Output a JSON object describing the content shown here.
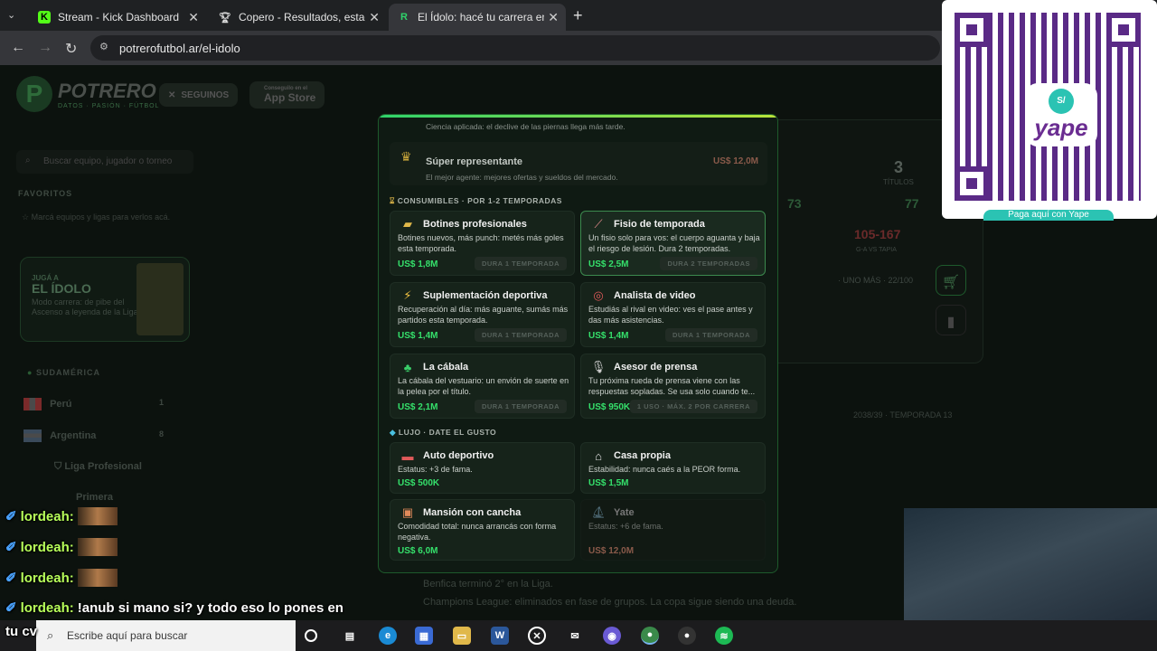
{
  "browser": {
    "tabs": [
      {
        "title": "Stream - Kick Dashboard",
        "icon": "kick-icon"
      },
      {
        "title": "Copero - Resultados, estadístic",
        "icon": "trophy-icon"
      },
      {
        "title": "El Ídolo: hacé tu carrera en la Li",
        "icon": "potrero-icon"
      }
    ],
    "url": "potrerofutbol.ar/el-idolo"
  },
  "site": {
    "brand": "POTRERO",
    "tagline": "DATOS · PASIÓN · FÚTBOL",
    "follow_label": "SEGUINOS",
    "appstore_small": "Conseguilo en el",
    "appstore_label": "App Store",
    "search_placeholder": "Buscar equipo, jugador o torneo",
    "favorites_heading": "FAVORITOS",
    "favorites_hint": "Marcá equipos y ligas para verlos acá.",
    "idolo_kicker": "JUGÁ A",
    "idolo_title": "EL ÍDOLO",
    "idolo_desc": "Modo carrera: de pibe del Ascenso a leyenda de la Liga",
    "region": "SUDAMÉRICA",
    "countries": [
      {
        "name": "Perú",
        "count": "1"
      },
      {
        "name": "Argentina",
        "count": "8"
      }
    ],
    "leagues": [
      "Liga Profesional",
      "Primera"
    ]
  },
  "modal": {
    "top_note": "Ciencia aplicada: el declive de las piernas llega más tarde.",
    "super_rep": {
      "title": "Súper representante",
      "desc": "El mejor agente: mejores ofertas y sueldos del mercado.",
      "price": "US$ 12,0M"
    },
    "consumibles_heading": "CONSUMIBLES · POR 1-2 TEMPORADAS",
    "consumibles": [
      {
        "title": "Botines profesionales",
        "desc": "Botines nuevos, más punch: metés más goles esta temporada.",
        "price": "US$ 1,8M",
        "duration": "DURA 1 TEMPORADA"
      },
      {
        "title": "Fisio de temporada",
        "desc": "Un fisio solo para vos: el cuerpo aguanta y baja el riesgo de lesión. Dura 2 temporadas.",
        "price": "US$ 2,5M",
        "duration": "DURA 2 TEMPORADAS"
      },
      {
        "title": "Suplementación deportiva",
        "desc": "Recuperación al día: más aguante, sumás más partidos esta temporada.",
        "price": "US$ 1,4M",
        "duration": "DURA 1 TEMPORADA"
      },
      {
        "title": "Analista de video",
        "desc": "Estudiás al rival en video: ves el pase antes y das más asistencias.",
        "price": "US$ 1,4M",
        "duration": "DURA 1 TEMPORADA"
      },
      {
        "title": "La cábala",
        "desc": "La cábala del vestuario: un envión de suerte en la pelea por el título.",
        "price": "US$ 2,1M",
        "duration": "DURA 1 TEMPORADA"
      },
      {
        "title": "Asesor de prensa",
        "desc": "Tu próxima rueda de prensa viene con las respuestas sopladas. Se usa solo cuando te...",
        "price": "US$ 950K",
        "duration": "1 USO · MÁX. 2 POR CARRERA"
      }
    ],
    "lujo_heading": "LUJO · DATE EL GUSTO",
    "lujo": [
      {
        "title": "Auto deportivo",
        "desc": "Estatus: +3 de fama.",
        "price": "US$ 500K"
      },
      {
        "title": "Casa propia",
        "desc": "Estabilidad: nunca caés a la PEOR forma.",
        "price": "US$ 1,5M"
      },
      {
        "title": "Mansión con cancha",
        "desc": "Comodidad total: nunca arrancás con forma negativa.",
        "price": "US$ 6,0M"
      },
      {
        "title": "Yate",
        "desc": "Estatus: +6 de fama.",
        "price": "US$ 12,0M"
      }
    ]
  },
  "right": {
    "titles_num": "3",
    "titles_label": "TÍTULOS",
    "stat_a": "73",
    "stat_b": "77",
    "record": "105-167",
    "record_sub": "G-A VS TAPIA",
    "progress_label": "· UNO MÁS · 22/100",
    "season": "2038/39 · TEMPORADA 13"
  },
  "feed": [
    "Benfica terminó 2° en la Liga.",
    "Champions League: eliminados en fase de grupos. La copa sigue siendo una deuda."
  ],
  "chat": [
    {
      "user": "lordeah:",
      "msg": ""
    },
    {
      "user": "lordeah:",
      "msg": ""
    },
    {
      "user": "lordeah:",
      "msg": ""
    },
    {
      "user": "lordeah:",
      "msg": "!anub si mano si? y todo eso lo pones en"
    }
  ],
  "chat_tail": "tu cv",
  "overlay": {
    "qr_label": "yape",
    "qr_coin": "S/",
    "qr_footer": "Paga aquí con Yape"
  },
  "taskbar": {
    "search_placeholder": "Escribe aquí para buscar"
  }
}
